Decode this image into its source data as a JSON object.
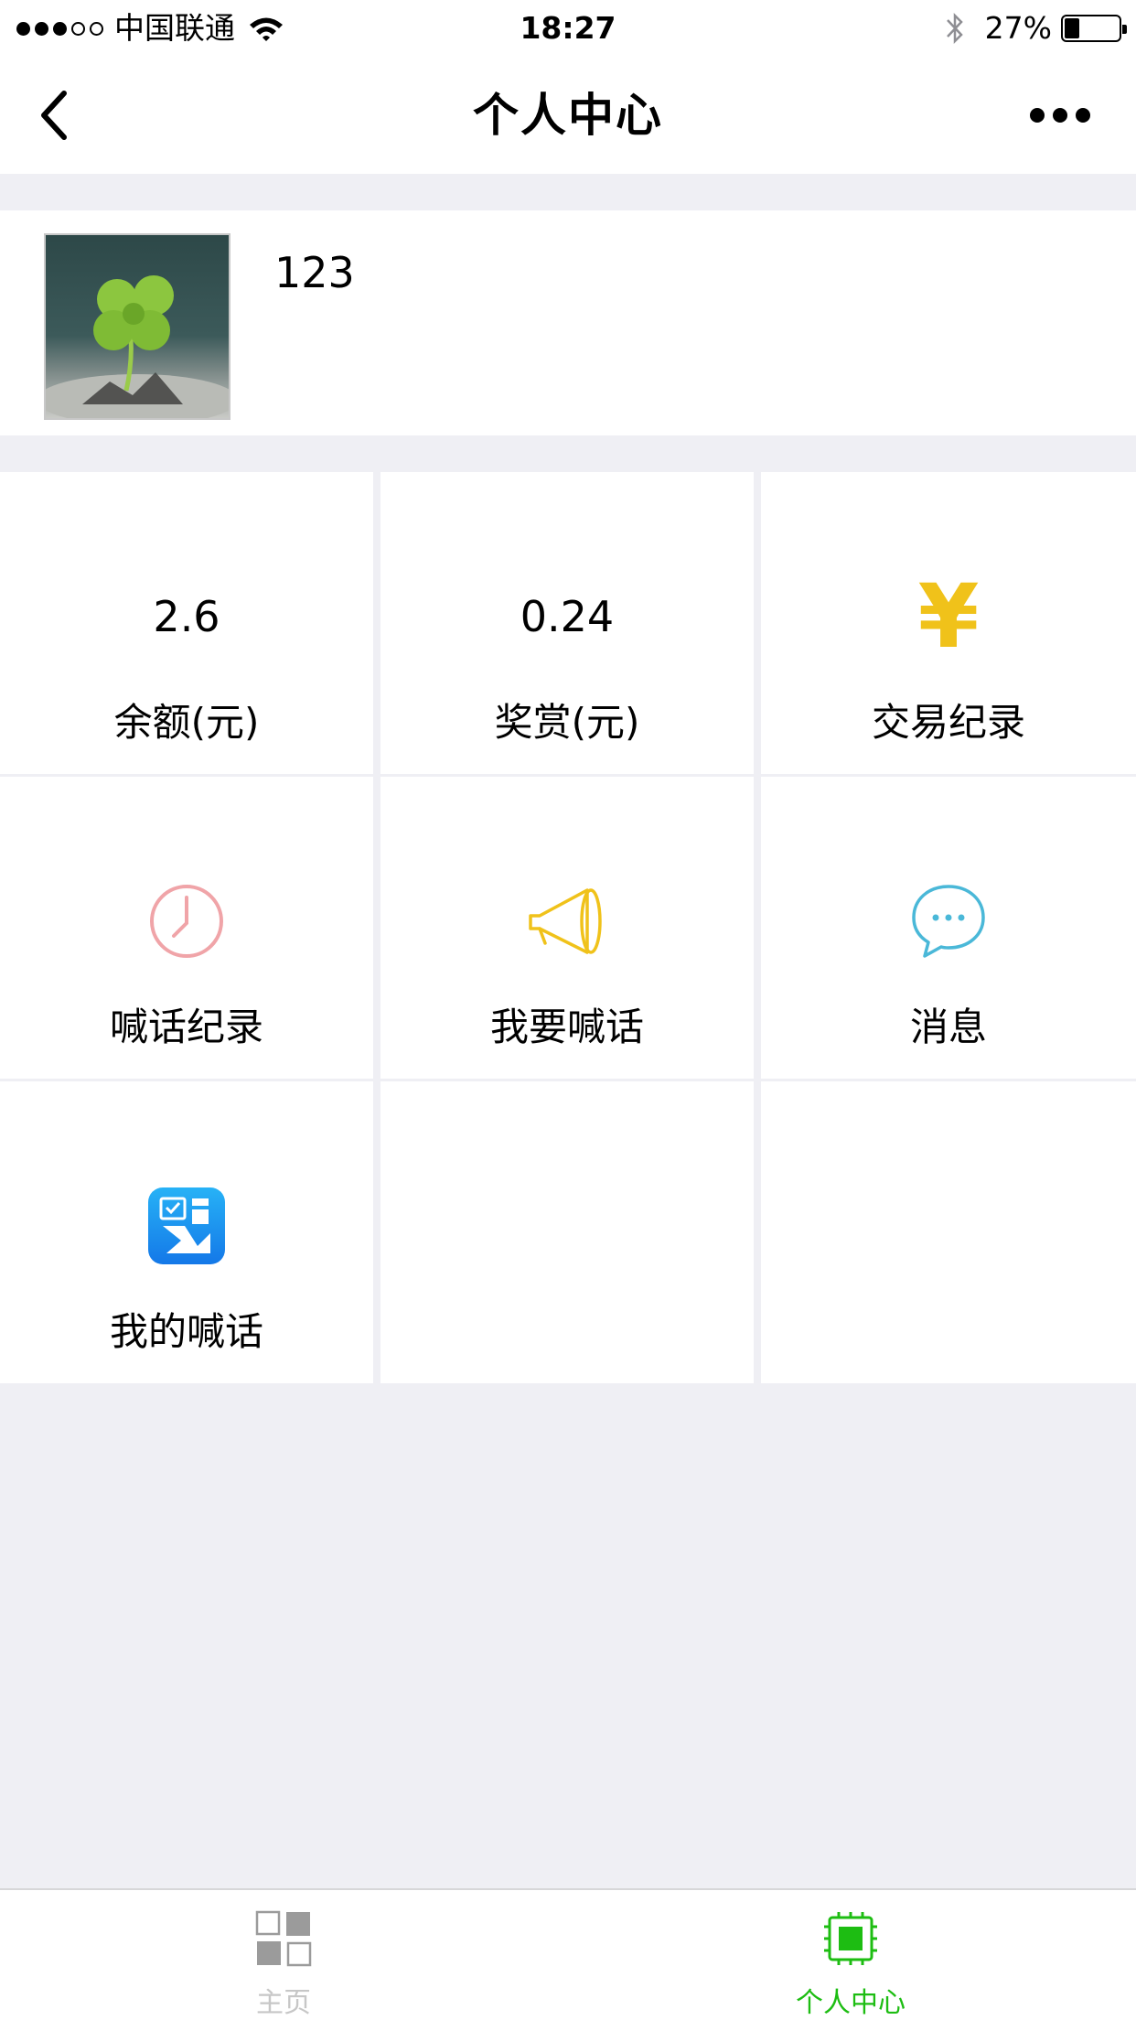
{
  "status_bar": {
    "carrier": "中国联通",
    "time": "18:27",
    "battery_percent_text": "27%",
    "battery_level": 0.27,
    "signal_bars_filled": 3,
    "signal_bars_total": 5
  },
  "nav": {
    "title": "个人中心",
    "back_icon": "chevron-left-icon",
    "more_icon": "more-dots-icon"
  },
  "profile": {
    "username": "123",
    "avatar_icon": "four-leaf-clover-photo"
  },
  "grid": {
    "balance": {
      "value": "2.6",
      "label": "余额(元)"
    },
    "reward": {
      "value": "0.24",
      "label": "奖赏(元)"
    },
    "transactions": {
      "icon_text": "¥",
      "label": "交易纪录",
      "icon": "yen-icon"
    },
    "shout_history": {
      "label": "喊话纪录",
      "icon": "clock-icon"
    },
    "shout": {
      "label": "我要喊话",
      "icon": "megaphone-icon"
    },
    "messages": {
      "label": "消息",
      "icon": "chat-bubble-icon"
    },
    "my_shouts": {
      "label": "我的喊话",
      "icon": "clipboard-person-icon"
    }
  },
  "tab_bar": {
    "tabs": [
      {
        "label": "主页",
        "icon": "grid-icon",
        "active": false
      },
      {
        "label": "个人中心",
        "icon": "chip-icon",
        "active": true
      }
    ]
  },
  "colors": {
    "background": "#efeff4",
    "accent_green": "#1dbd12",
    "yen_gold": "#f0c21a",
    "clock_pink": "#f0a4a8",
    "megaphone_yellow": "#f0c21a",
    "chat_blue": "#4ab8d8",
    "app_icon_blue": "#1a8cf0"
  }
}
